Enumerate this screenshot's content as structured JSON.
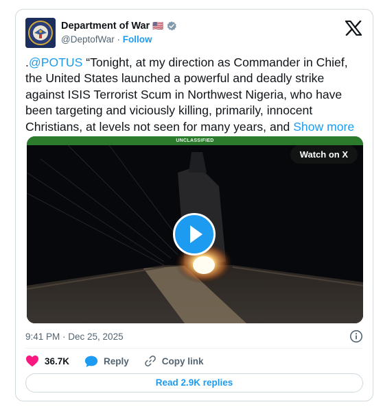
{
  "account": {
    "display_name": "Department of War",
    "flag": "🇺🇸",
    "handle": "@DeptofWar",
    "separator": "·",
    "follow_label": "Follow"
  },
  "tweet": {
    "prefix": ".",
    "mention": "@POTUS",
    "body": " “Tonight, at my direction as Commander in Chief, the United States launched a powerful and deadly strike against ISIS Terrorist Scum in Northwest Nigeria, who have been targeting and viciously killing, primarily, innocent Christians, at levels not seen for many years, and ",
    "show_more": "Show more"
  },
  "media": {
    "banner_text": "UNCLASSIFIED",
    "watch_label": "Watch on X"
  },
  "timestamp": "9:41 PM · Dec 25, 2025",
  "actions": {
    "likes": "36.7K",
    "reply_label": "Reply",
    "copy_label": "Copy link"
  },
  "replies_button": "Read 2.9K replies",
  "colors": {
    "accent": "#1d9bf0",
    "like": "#f91880",
    "banner": "#2c7a2c"
  }
}
